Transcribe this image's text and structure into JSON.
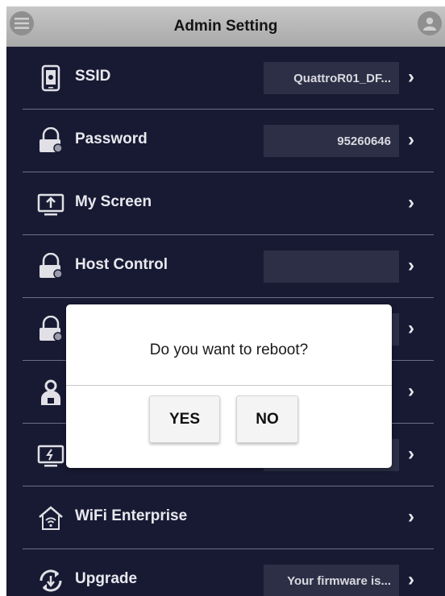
{
  "header": {
    "title": "Admin Setting",
    "left_icon": "menu-icon",
    "right_icon": "user-icon"
  },
  "rows": [
    {
      "label": "SSID",
      "value": "QuattroR01_DF...",
      "icon": "tablet-settings-icon"
    },
    {
      "label": "Password",
      "value": "95260646",
      "icon": "lock-icon"
    },
    {
      "label": "My Screen",
      "value": "",
      "icon": "screen-upload-icon"
    },
    {
      "label": "Host Control",
      "value": "",
      "icon": "lock-icon"
    },
    {
      "label": "",
      "value": "",
      "icon": "lock-icon"
    },
    {
      "label": "",
      "value": "",
      "icon": "user-lock-icon"
    },
    {
      "label": "",
      "value": "",
      "icon": "screen-power-icon"
    },
    {
      "label": "WiFi Enterprise",
      "value": "",
      "icon": "home-wifi-icon"
    },
    {
      "label": "Upgrade",
      "value": "Your firmware is...",
      "icon": "upgrade-icon"
    }
  ],
  "dialog": {
    "message": "Do you want to reboot?",
    "yes_label": "YES",
    "no_label": "NO"
  },
  "colors": {
    "background": "#181a33",
    "header": "#b5b5b5",
    "value_box": "#2d2f46",
    "text": "#e8e8ee"
  }
}
